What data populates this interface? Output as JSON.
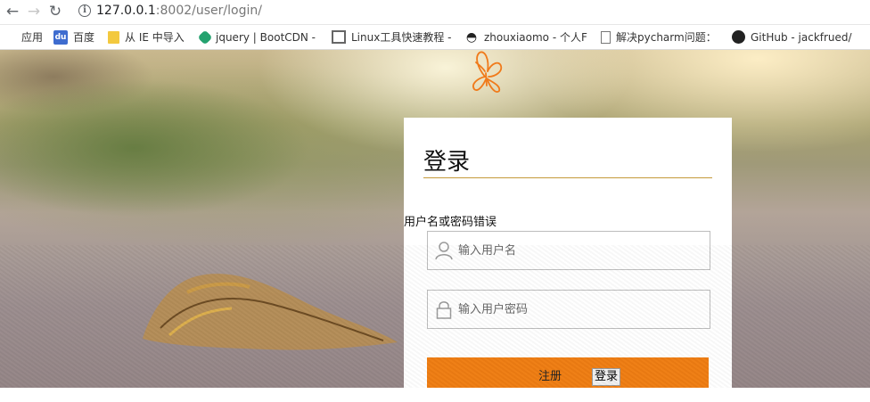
{
  "browser": {
    "back_icon": "arrow-left-icon",
    "forward_icon": "arrow-right-icon",
    "reload_icon": "reload-icon",
    "url_host": "127.0.0.1",
    "url_rest": ":8002/user/login/"
  },
  "bookmarks": [
    {
      "label": "应用",
      "icon": "apps-grid-icon"
    },
    {
      "label": "百度",
      "icon": "baidu-icon"
    },
    {
      "label": "从 IE 中导入",
      "icon": "folder-icon"
    },
    {
      "label": "jquery | BootCDN -",
      "icon": "bootcdn-icon"
    },
    {
      "label": "Linux工具快速教程 -",
      "icon": "book-icon"
    },
    {
      "label": "zhouxiaomo - 个人F",
      "icon": "avatar-icon"
    },
    {
      "label": "解决pycharm问题：",
      "icon": "page-icon"
    },
    {
      "label": "GitHub - jackfrued/",
      "icon": "github-icon"
    }
  ],
  "login": {
    "title": "登录",
    "error": "用户名或密码错误",
    "username_placeholder": "输入用户名",
    "password_placeholder": "输入用户密码",
    "register_label": "注册",
    "login_label": "登录",
    "accent_color": "#ef7d12"
  }
}
